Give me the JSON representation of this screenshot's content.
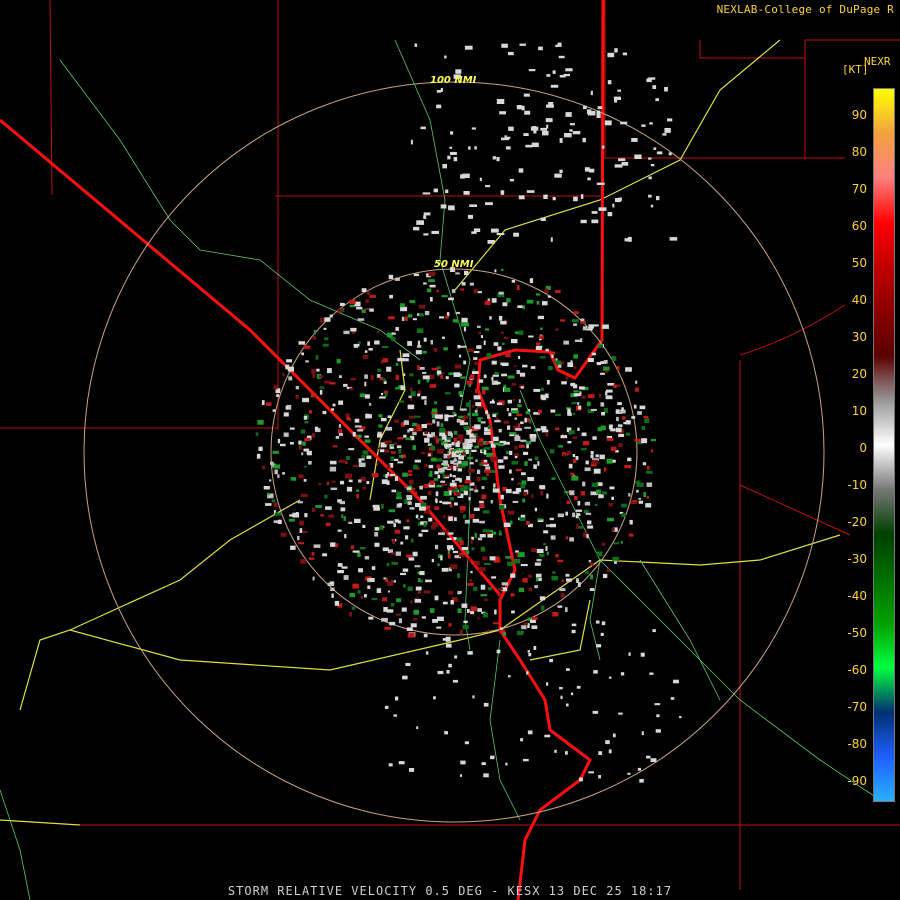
{
  "header": {
    "credit": "NEXLAB-College of DuPage R",
    "product": "NEXR",
    "unit": "[KT]"
  },
  "range_rings": {
    "inner_label": "50 NMI",
    "outer_label": "100 NMI"
  },
  "color_scale": {
    "ticks": [
      "90",
      "80",
      "70",
      "60",
      "50",
      "40",
      "30",
      "20",
      "10",
      "0",
      "-10",
      "-20",
      "-30",
      "-40",
      "-50",
      "-60",
      "-70",
      "-80",
      "-90"
    ],
    "colors": [
      "#ffff00",
      "#f2a040",
      "#ff7f7f",
      "#ff0000",
      "#c00000",
      "#8a0000",
      "#5a0000",
      "#999999",
      "#ffffff",
      "#777777",
      "#004000",
      "#007000",
      "#00a000",
      "#00ff40",
      "#003070",
      "#1f5fff",
      "#2ab0ff"
    ]
  },
  "footer": {
    "caption": "STORM RELATIVE VELOCITY 0.5 DEG - KESX 13 DEC 25 18:17"
  }
}
